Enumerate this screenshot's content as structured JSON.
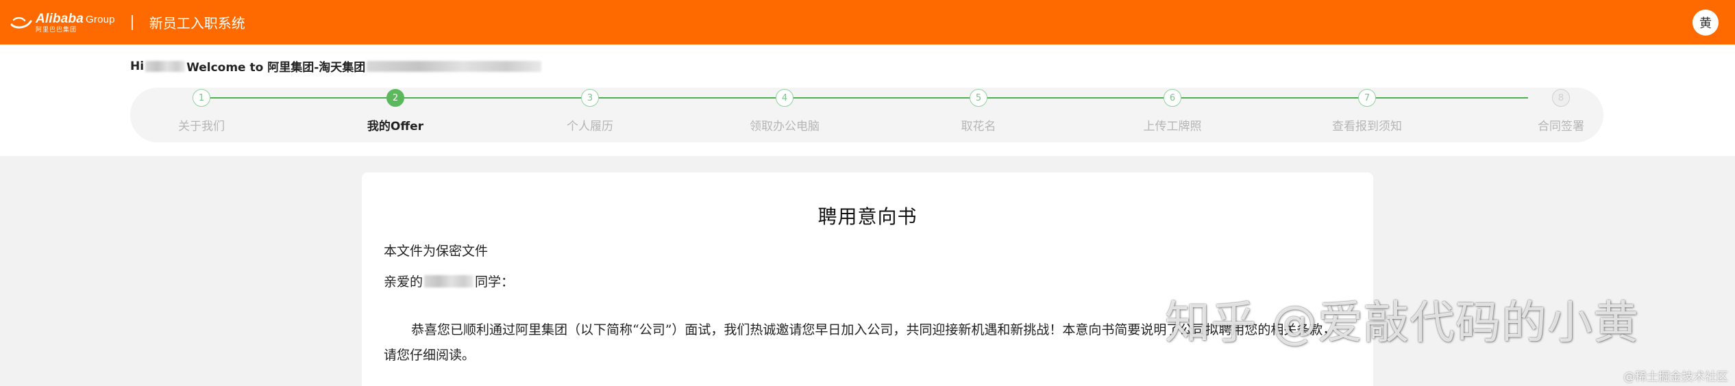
{
  "header": {
    "logo_name": "Alibaba",
    "logo_group": "Group",
    "logo_sub": "阿里巴巴集团",
    "app_title": "新员工入职系统",
    "avatar_char": "黄",
    "brand_color": "#ff6a00"
  },
  "greeting": {
    "prefix": "Hi",
    "welcome": "Welcome to 阿里集团-淘天集团"
  },
  "steps": [
    {
      "num": "1",
      "label": "关于我们",
      "state": "done"
    },
    {
      "num": "2",
      "label": "我的Offer",
      "state": "active"
    },
    {
      "num": "3",
      "label": "个人履历",
      "state": "todo"
    },
    {
      "num": "4",
      "label": "领取办公电脑",
      "state": "todo"
    },
    {
      "num": "5",
      "label": "取花名",
      "state": "todo"
    },
    {
      "num": "6",
      "label": "上传工牌照",
      "state": "todo"
    },
    {
      "num": "7",
      "label": "查看报到须知",
      "state": "todo"
    },
    {
      "num": "8",
      "label": "合同签署",
      "state": "pending"
    }
  ],
  "document": {
    "title": "聘用意向书",
    "confidential": "本文件为保密文件",
    "salutation_prefix": "亲爱的",
    "salutation_suffix": "同学：",
    "paragraph": "恭喜您已顺利通过阿里集团（以下简称“公司”）面试，我们热诚邀请您早日加入公司，共同迎接新机遇和新挑战！本意向书简要说明了公司拟聘用您的相关条款，请您仔细阅读。"
  },
  "watermark": {
    "main": "知乎 @爱敲代码的小黄",
    "small": "@稀土掘金技术社区"
  }
}
